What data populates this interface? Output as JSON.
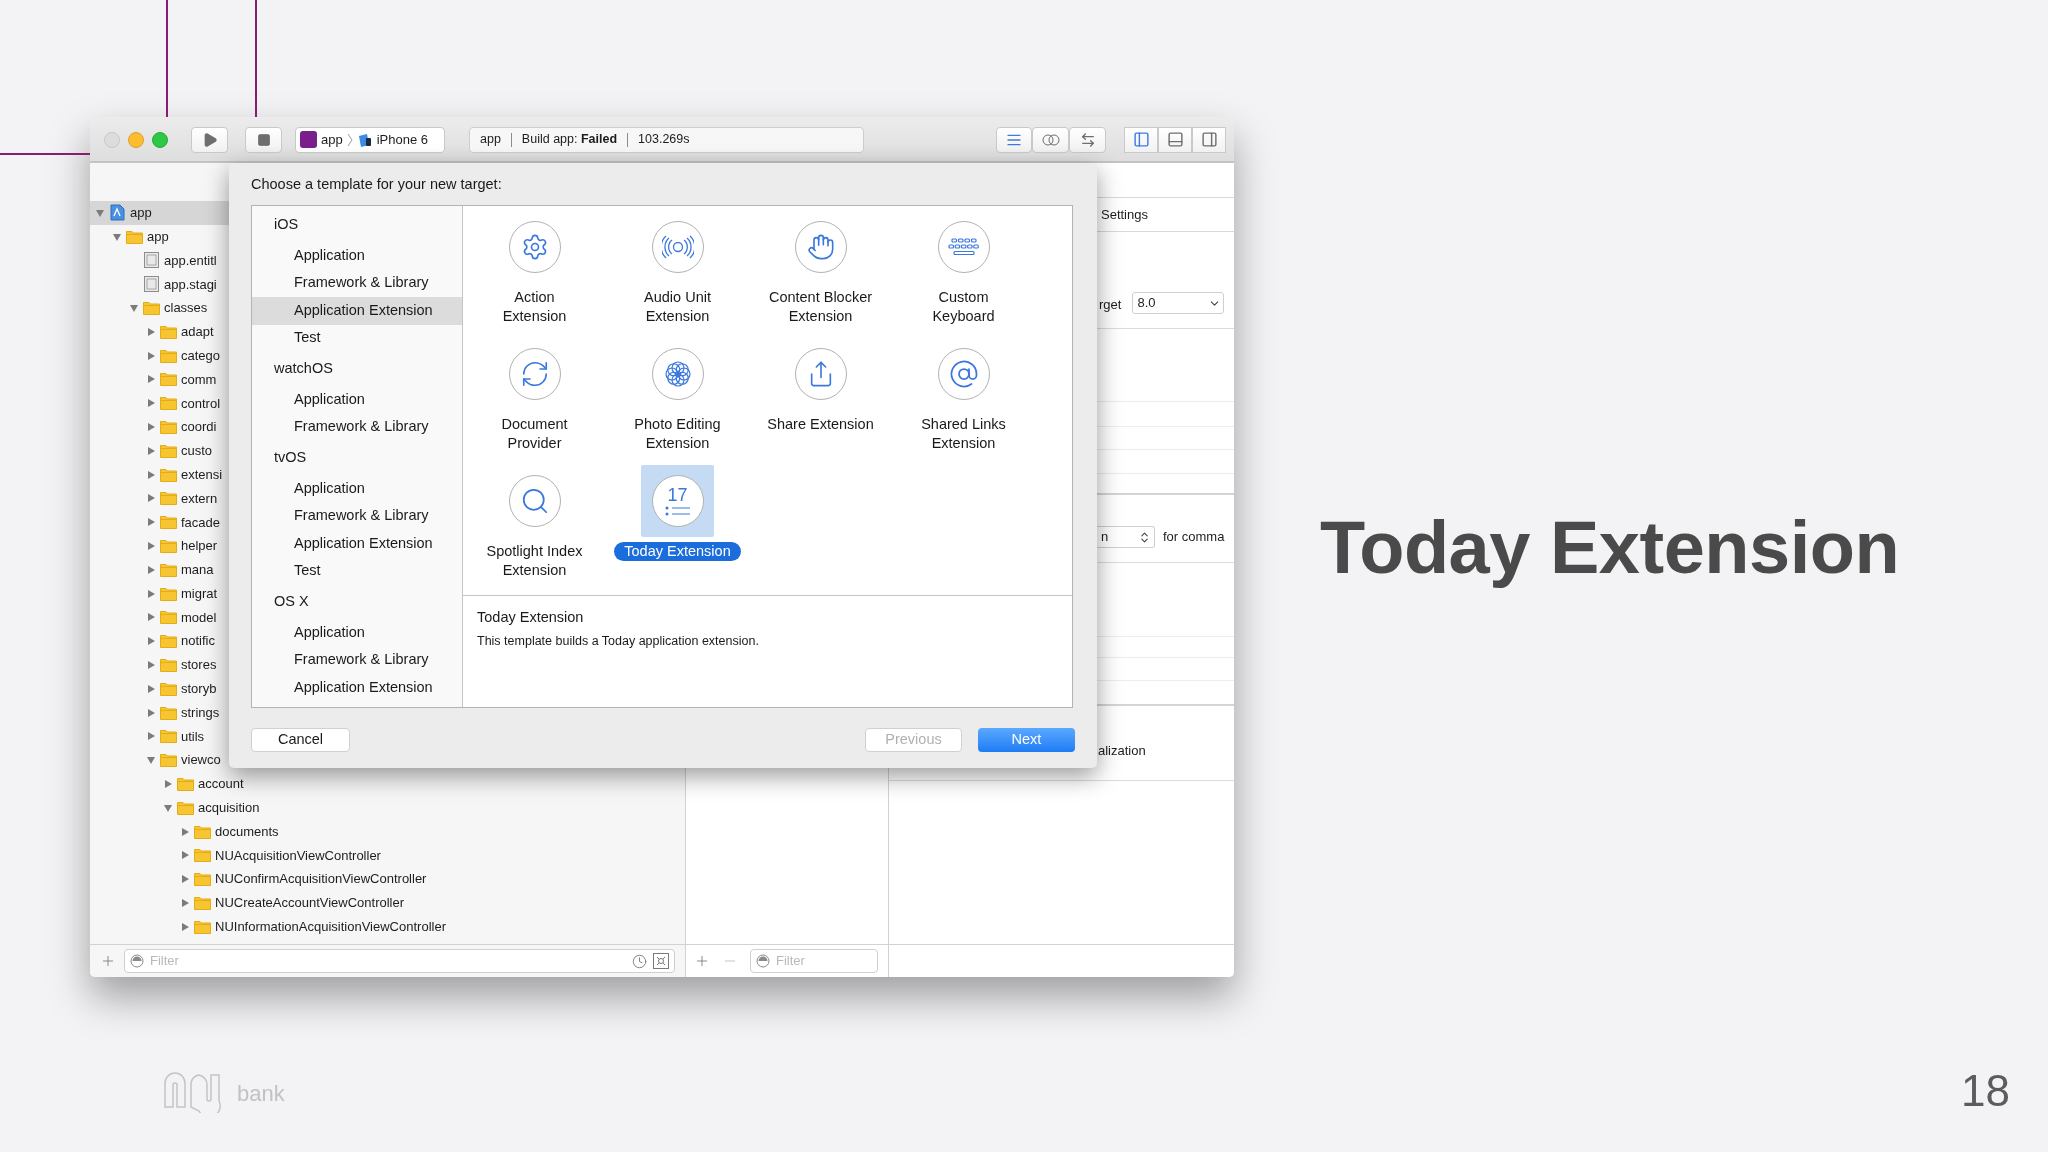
{
  "toolbar": {
    "scheme": {
      "target": "app",
      "device": "iPhone 6"
    },
    "activity": {
      "project": "app",
      "status": "Build app: **Failed**",
      "time": "103.269s"
    },
    "panel_toggles": [
      {
        "selected": true
      },
      {
        "selected": false
      },
      {
        "selected": false
      }
    ]
  },
  "navigator": {
    "tree": [
      {
        "label": "app",
        "kind": "project",
        "expanded": true,
        "selected": true,
        "children": [
          {
            "label": "app",
            "kind": "folder",
            "expanded": true,
            "selected": false,
            "children": [
              {
                "label": "app.entitl",
                "kind": "file",
                "selected": false
              },
              {
                "label": "app.stagi",
                "kind": "file",
                "selected": false
              },
              {
                "label": "classes",
                "kind": "folder",
                "expanded": true,
                "selected": false,
                "children": [
                  {
                    "label": "adapt",
                    "kind": "folder",
                    "expanded": false,
                    "selected": false
                  },
                  {
                    "label": "catego",
                    "kind": "folder",
                    "expanded": false,
                    "selected": false
                  },
                  {
                    "label": "comm",
                    "kind": "folder",
                    "expanded": false,
                    "selected": false
                  },
                  {
                    "label": "control",
                    "kind": "folder",
                    "expanded": false,
                    "selected": false
                  },
                  {
                    "label": "coordi",
                    "kind": "folder",
                    "expanded": false,
                    "selected": false
                  },
                  {
                    "label": "custo",
                    "kind": "folder",
                    "expanded": false,
                    "selected": false
                  },
                  {
                    "label": "extensi",
                    "kind": "folder",
                    "expanded": false,
                    "selected": false
                  },
                  {
                    "label": "extern",
                    "kind": "folder",
                    "expanded": false,
                    "selected": false
                  },
                  {
                    "label": "facade",
                    "kind": "folder",
                    "expanded": false,
                    "selected": false
                  },
                  {
                    "label": "helper",
                    "kind": "folder",
                    "expanded": false,
                    "selected": false
                  },
                  {
                    "label": "mana",
                    "kind": "folder",
                    "expanded": false,
                    "selected": false
                  },
                  {
                    "label": "migrat",
                    "kind": "folder",
                    "expanded": false,
                    "selected": false
                  },
                  {
                    "label": "model",
                    "kind": "folder",
                    "expanded": false,
                    "selected": false
                  },
                  {
                    "label": "notific",
                    "kind": "folder",
                    "expanded": false,
                    "selected": false
                  },
                  {
                    "label": "stores",
                    "kind": "folder",
                    "expanded": false,
                    "selected": false
                  },
                  {
                    "label": "storyb",
                    "kind": "folder",
                    "expanded": false,
                    "selected": false
                  },
                  {
                    "label": "strings",
                    "kind": "folder",
                    "expanded": false,
                    "selected": false
                  },
                  {
                    "label": "utils",
                    "kind": "folder",
                    "expanded": false,
                    "selected": false
                  },
                  {
                    "label": "viewco",
                    "kind": "folder",
                    "expanded": true,
                    "selected": false,
                    "children": [
                      {
                        "label": "account",
                        "kind": "folder",
                        "expanded": false,
                        "selected": false
                      },
                      {
                        "label": "acquisition",
                        "kind": "folder",
                        "expanded": true,
                        "selected": false,
                        "children": [
                          {
                            "label": "documents",
                            "kind": "folder",
                            "expanded": false,
                            "selected": false
                          },
                          {
                            "label": "NUAcquisitionViewController",
                            "kind": "folder",
                            "expanded": false,
                            "selected": false
                          },
                          {
                            "label": "NUConfirmAcquisitionViewController",
                            "kind": "folder",
                            "expanded": false,
                            "selected": false
                          },
                          {
                            "label": "NUCreateAccountViewController",
                            "kind": "folder",
                            "expanded": false,
                            "selected": false
                          },
                          {
                            "label": "NUInformationAcquisitionViewController",
                            "kind": "folder",
                            "expanded": false,
                            "selected": false
                          }
                        ]
                      }
                    ]
                  }
                ]
              }
            ]
          }
        ]
      }
    ],
    "filter_placeholder": "Filter"
  },
  "middle_panel": {
    "filter_placeholder": "Filter"
  },
  "inspector": {
    "tab_label": "Settings",
    "target_label": "rget",
    "target_value": "8.0",
    "popup_value": "n",
    "popup_note": "for comma",
    "section_label": "alization"
  },
  "dialog": {
    "title": "Choose a template for your new target:",
    "categories": [
      {
        "label": "iOS",
        "children": [
          {
            "label": "Application",
            "selected": false
          },
          {
            "label": "Framework & Library",
            "selected": false
          },
          {
            "label": "Application Extension",
            "selected": true
          },
          {
            "label": "Test",
            "selected": false
          }
        ]
      },
      {
        "label": "watchOS",
        "children": [
          {
            "label": "Application",
            "selected": false
          },
          {
            "label": "Framework & Library",
            "selected": false
          }
        ]
      },
      {
        "label": "tvOS",
        "children": [
          {
            "label": "Application",
            "selected": false
          },
          {
            "label": "Framework & Library",
            "selected": false
          },
          {
            "label": "Application Extension",
            "selected": false
          },
          {
            "label": "Test",
            "selected": false
          }
        ]
      },
      {
        "label": "OS X",
        "children": [
          {
            "label": "Application",
            "selected": false
          },
          {
            "label": "Framework & Library",
            "selected": false
          },
          {
            "label": "Application Extension",
            "selected": false
          }
        ]
      }
    ],
    "templates": [
      {
        "label": "Action\nExtension",
        "kind": "gear",
        "selected": false
      },
      {
        "label": "Audio Unit\nExtension",
        "kind": "waves",
        "selected": false
      },
      {
        "label": "Content Blocker\nExtension",
        "kind": "hand",
        "selected": false
      },
      {
        "label": "Custom\nKeyboard",
        "kind": "keyboard",
        "selected": false
      },
      {
        "label": "Document\nProvider",
        "kind": "sync",
        "selected": false
      },
      {
        "label": "Photo Editing\nExtension",
        "kind": "flower",
        "selected": false
      },
      {
        "label": "Share Extension",
        "kind": "share",
        "selected": false
      },
      {
        "label": "Shared Links\nExtension",
        "kind": "at",
        "selected": false
      },
      {
        "label": "Spotlight Index\nExtension",
        "kind": "search",
        "selected": false
      },
      {
        "label": "Today Extension",
        "kind": "calendar",
        "icon_text": "17",
        "selected": true
      }
    ],
    "description": {
      "title": "Today Extension",
      "text": "This template builds a Today application extension."
    },
    "buttons": [
      {
        "label": "Cancel",
        "kind": "normal",
        "disabled": false
      },
      {
        "label": "Previous",
        "kind": "normal",
        "disabled": true
      },
      {
        "label": "Next",
        "kind": "default",
        "disabled": false
      }
    ]
  },
  "slide": {
    "title": "Today Extension",
    "page_number": "18",
    "logo_text": "bank"
  }
}
